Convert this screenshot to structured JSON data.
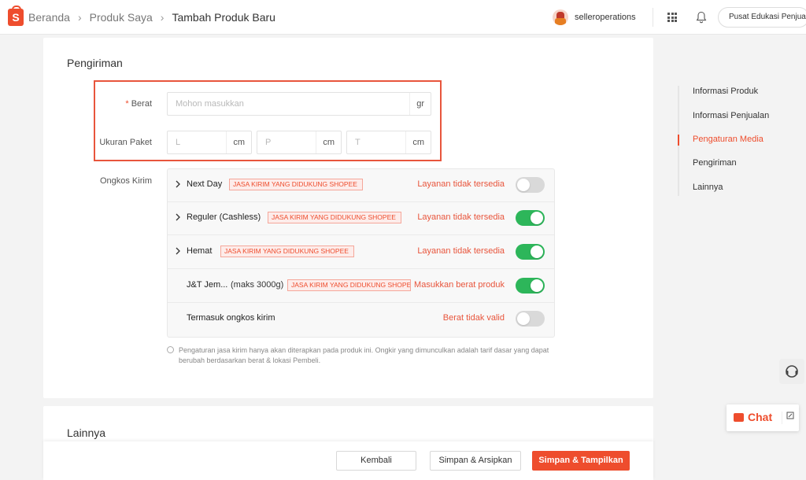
{
  "breadcrumb": {
    "home": "Beranda",
    "products": "Produk Saya",
    "current": "Tambah Produk Baru"
  },
  "header": {
    "username": "selleroperations",
    "education_button": "Pusat Edukasi Penjual"
  },
  "shipping": {
    "section_title": "Pengiriman",
    "weight_label": "Berat",
    "weight_required_mark": "*",
    "weight_placeholder": "Mohon masukkan",
    "weight_unit": "gr",
    "package_label": "Ukuran Paket",
    "dims": [
      {
        "placeholder": "L",
        "unit": "cm"
      },
      {
        "placeholder": "P",
        "unit": "cm"
      },
      {
        "placeholder": "T",
        "unit": "cm"
      }
    ],
    "cost_label": "Ongkos Kirim",
    "options": [
      {
        "name": "Next Day",
        "extra": "",
        "badge": "JASA KIRIM YANG DIDUKUNG SHOPEE",
        "status": "Layanan tidak tersedia",
        "enabled": false,
        "expandable": true
      },
      {
        "name": "Reguler (Cashless)",
        "extra": "",
        "badge": "JASA KIRIM YANG DIDUKUNG SHOPEE",
        "status": "Layanan tidak tersedia",
        "enabled": true,
        "expandable": true
      },
      {
        "name": "Hemat",
        "extra": "",
        "badge": "JASA KIRIM YANG DIDUKUNG SHOPEE",
        "status": "Layanan tidak tersedia",
        "enabled": true,
        "expandable": true
      },
      {
        "name": "J&T Jem...",
        "extra": "(maks 3000g)",
        "badge": "JASA KIRIM YANG DIDUKUNG SHOPEE",
        "status": "Masukkan berat produk",
        "enabled": true,
        "expandable": false
      },
      {
        "name": "Termasuk ongkos kirim",
        "extra": "",
        "badge": "",
        "status": "Berat tidak valid",
        "enabled": false,
        "expandable": false
      }
    ],
    "note": "Pengaturan jasa kirim hanya akan diterapkan pada produk ini. Ongkir yang dimunculkan adalah tarif dasar yang dapat berubah berdasarkan berat & lokasi Pembeli."
  },
  "other_section": {
    "title": "Lainnya"
  },
  "footer": {
    "back": "Kembali",
    "save_archive": "Simpan & Arsipkan",
    "save_show": "Simpan & Tampilkan"
  },
  "sidenav": {
    "items": [
      "Informasi Produk",
      "Informasi Penjualan",
      "Pengaturan Media",
      "Pengiriman",
      "Lainnya"
    ],
    "active_index": 2
  },
  "chat": {
    "label": "Chat"
  },
  "colors": {
    "accent": "#ee4d2d",
    "toggle_on": "#2db65a",
    "toggle_off": "#d9d9d9"
  },
  "icons": [
    "shopee-logo-icon",
    "chevron-right-icon",
    "grid-apps-icon",
    "bell-icon",
    "info-icon",
    "headset-icon",
    "chat-bubble-icon",
    "expand-icon"
  ]
}
